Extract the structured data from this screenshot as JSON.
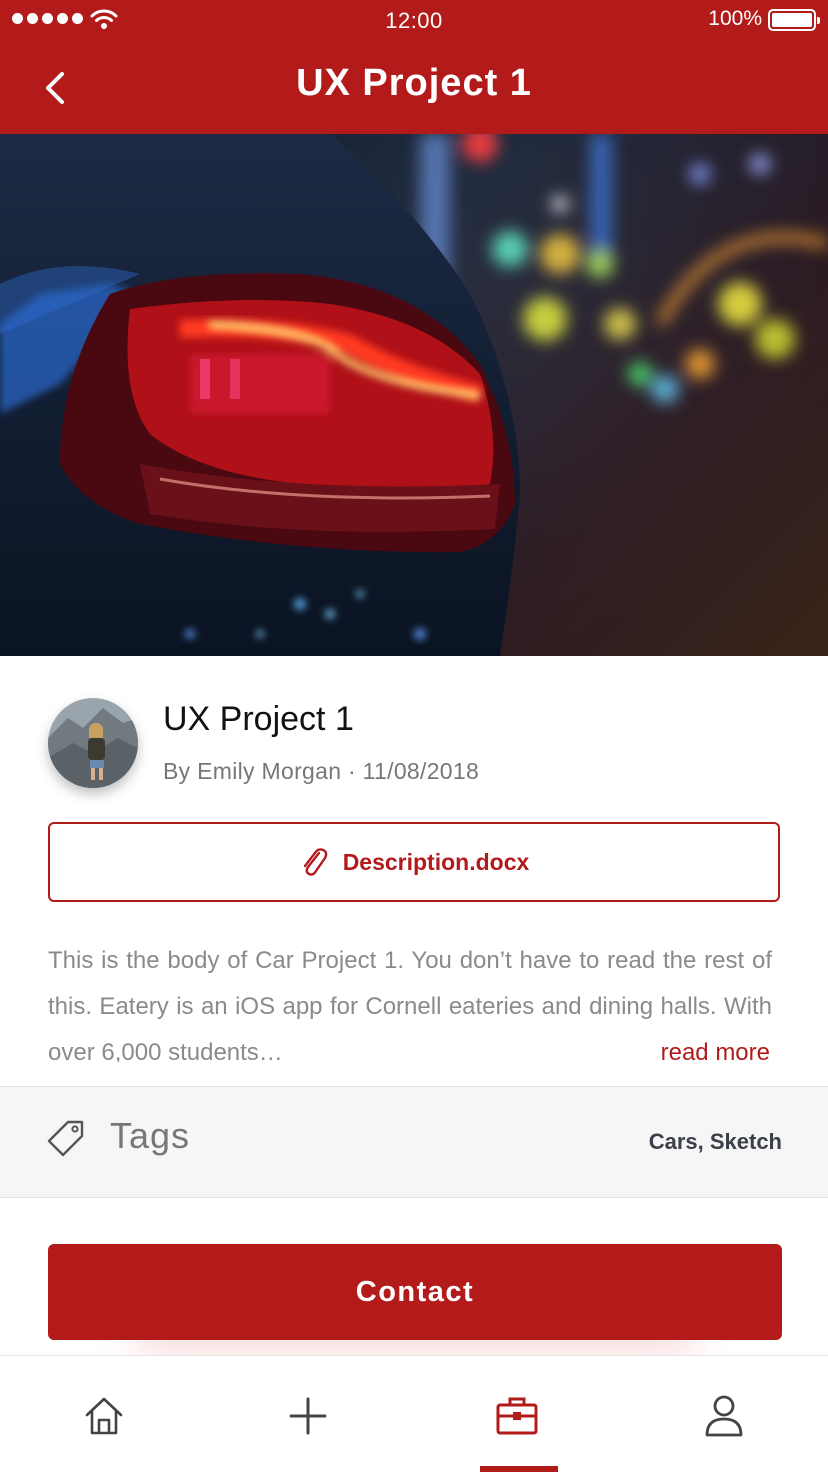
{
  "status_bar": {
    "time": "12:00",
    "battery": "100%"
  },
  "nav": {
    "title": "UX Project 1",
    "back_icon": "chevron-left-icon"
  },
  "project": {
    "title": "UX Project 1",
    "byline": "By Emily Morgan · 11/08/2018",
    "attachment": {
      "icon": "paperclip-icon",
      "filename": "Description.docx"
    },
    "body": "This is the body of Car Project 1. You don’t have to read the rest of this. Eatery is an iOS app for Cornell eateries and dining halls. With over 6,000 students…",
    "read_more": "read more"
  },
  "tags": {
    "icon": "tag-icon",
    "label": "Tags",
    "value": "Cars, Sketch"
  },
  "contact_button": {
    "label": "Contact"
  },
  "tab_bar": {
    "items": [
      {
        "icon": "home-icon",
        "active": false
      },
      {
        "icon": "plus-icon",
        "active": false
      },
      {
        "icon": "briefcase-icon",
        "active": true
      },
      {
        "icon": "user-icon",
        "active": false
      }
    ]
  },
  "colors": {
    "accent": "#B31B1B",
    "text_muted": "#8a8a8a",
    "tags_background": "#f6f6f6"
  }
}
